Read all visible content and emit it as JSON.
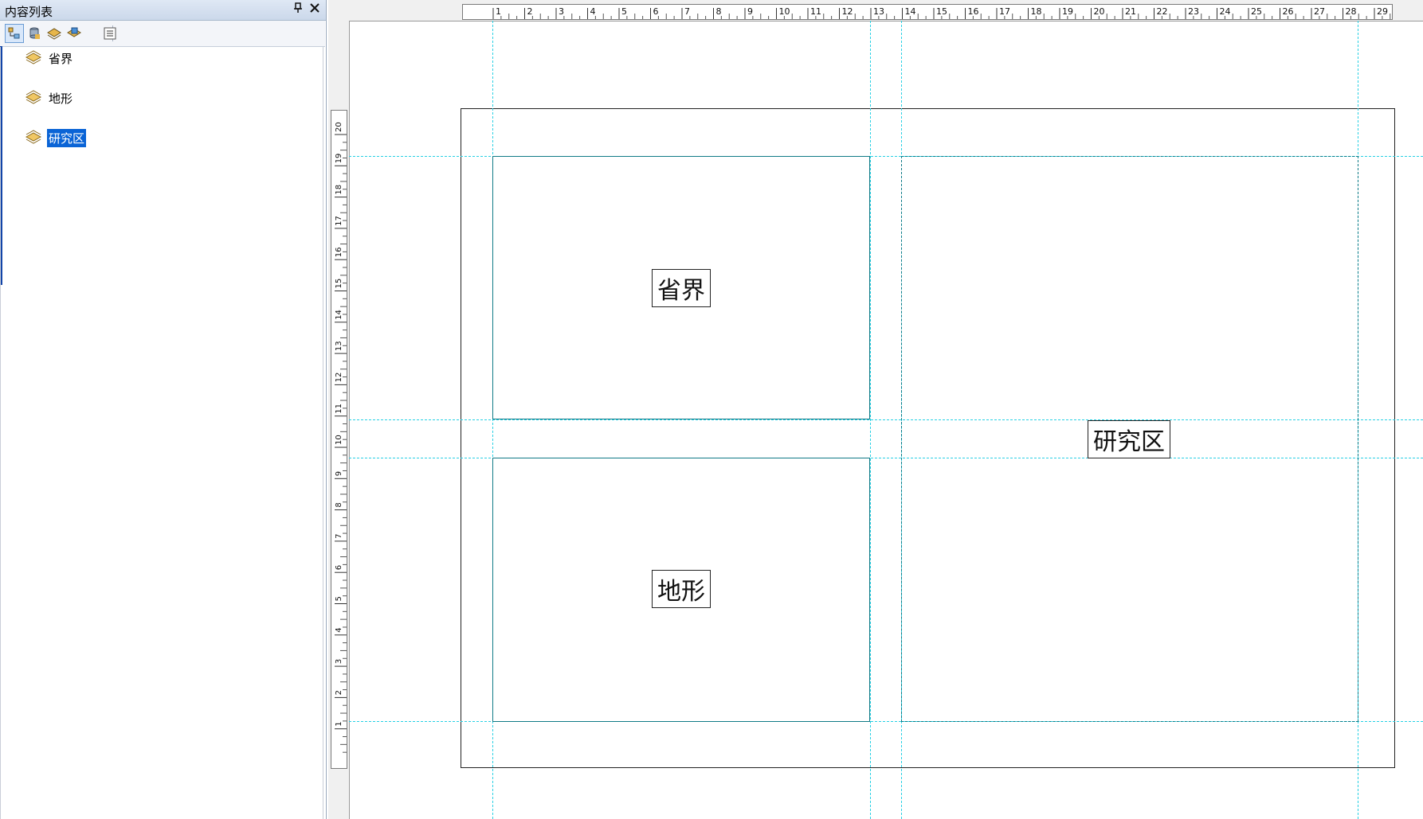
{
  "toc": {
    "title": "内容列表",
    "pin_glyph": "📌",
    "close_glyph": "✕",
    "toolbar": [
      "list-by-drawing-order-icon",
      "list-by-source-icon",
      "list-by-visibility-icon",
      "list-by-selection-icon",
      "options-icon"
    ],
    "layers": [
      {
        "label": "省界",
        "selected": false
      },
      {
        "label": "地形",
        "selected": false
      },
      {
        "label": "研究区",
        "selected": true
      }
    ]
  },
  "rulers": {
    "horizontal_labels": [
      "1",
      "2",
      "3",
      "4",
      "5",
      "6",
      "7",
      "8",
      "9",
      "10",
      "11",
      "12",
      "13",
      "14",
      "15",
      "16",
      "17",
      "18",
      "19",
      "20",
      "21",
      "22",
      "23",
      "24",
      "25",
      "26",
      "27",
      "28",
      "29"
    ],
    "vertical_labels": [
      "20",
      "19",
      "18",
      "17",
      "16",
      "15",
      "14",
      "13",
      "12",
      "11",
      "10",
      "9",
      "8",
      "7",
      "6",
      "5",
      "4",
      "3",
      "2",
      "1"
    ]
  },
  "frames": [
    {
      "label": "省界"
    },
    {
      "label": "地形"
    },
    {
      "label": "研究区"
    }
  ],
  "colors": {
    "selection": "#0a64d6",
    "guide": "#28d0e4",
    "frame": "#0f7a86"
  }
}
